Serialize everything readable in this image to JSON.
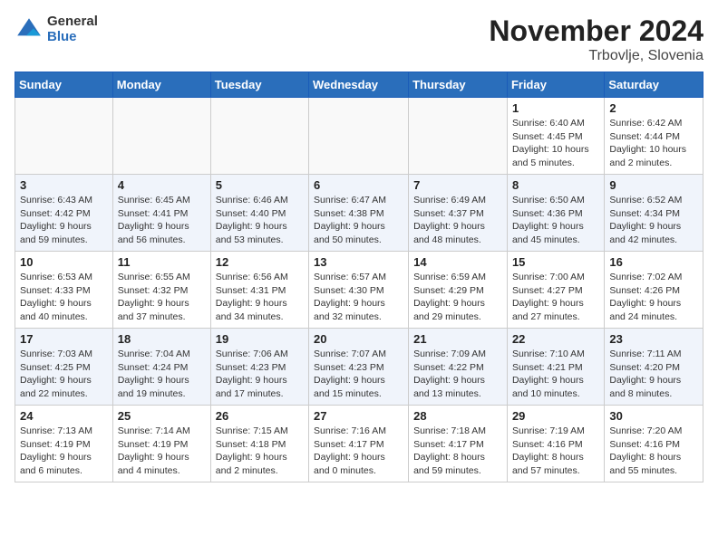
{
  "logo": {
    "general": "General",
    "blue": "Blue"
  },
  "header": {
    "month": "November 2024",
    "location": "Trbovlje, Slovenia"
  },
  "weekdays": [
    "Sunday",
    "Monday",
    "Tuesday",
    "Wednesday",
    "Thursday",
    "Friday",
    "Saturday"
  ],
  "weeks": [
    [
      {
        "day": "",
        "info": ""
      },
      {
        "day": "",
        "info": ""
      },
      {
        "day": "",
        "info": ""
      },
      {
        "day": "",
        "info": ""
      },
      {
        "day": "",
        "info": ""
      },
      {
        "day": "1",
        "info": "Sunrise: 6:40 AM\nSunset: 4:45 PM\nDaylight: 10 hours\nand 5 minutes."
      },
      {
        "day": "2",
        "info": "Sunrise: 6:42 AM\nSunset: 4:44 PM\nDaylight: 10 hours\nand 2 minutes."
      }
    ],
    [
      {
        "day": "3",
        "info": "Sunrise: 6:43 AM\nSunset: 4:42 PM\nDaylight: 9 hours\nand 59 minutes."
      },
      {
        "day": "4",
        "info": "Sunrise: 6:45 AM\nSunset: 4:41 PM\nDaylight: 9 hours\nand 56 minutes."
      },
      {
        "day": "5",
        "info": "Sunrise: 6:46 AM\nSunset: 4:40 PM\nDaylight: 9 hours\nand 53 minutes."
      },
      {
        "day": "6",
        "info": "Sunrise: 6:47 AM\nSunset: 4:38 PM\nDaylight: 9 hours\nand 50 minutes."
      },
      {
        "day": "7",
        "info": "Sunrise: 6:49 AM\nSunset: 4:37 PM\nDaylight: 9 hours\nand 48 minutes."
      },
      {
        "day": "8",
        "info": "Sunrise: 6:50 AM\nSunset: 4:36 PM\nDaylight: 9 hours\nand 45 minutes."
      },
      {
        "day": "9",
        "info": "Sunrise: 6:52 AM\nSunset: 4:34 PM\nDaylight: 9 hours\nand 42 minutes."
      }
    ],
    [
      {
        "day": "10",
        "info": "Sunrise: 6:53 AM\nSunset: 4:33 PM\nDaylight: 9 hours\nand 40 minutes."
      },
      {
        "day": "11",
        "info": "Sunrise: 6:55 AM\nSunset: 4:32 PM\nDaylight: 9 hours\nand 37 minutes."
      },
      {
        "day": "12",
        "info": "Sunrise: 6:56 AM\nSunset: 4:31 PM\nDaylight: 9 hours\nand 34 minutes."
      },
      {
        "day": "13",
        "info": "Sunrise: 6:57 AM\nSunset: 4:30 PM\nDaylight: 9 hours\nand 32 minutes."
      },
      {
        "day": "14",
        "info": "Sunrise: 6:59 AM\nSunset: 4:29 PM\nDaylight: 9 hours\nand 29 minutes."
      },
      {
        "day": "15",
        "info": "Sunrise: 7:00 AM\nSunset: 4:27 PM\nDaylight: 9 hours\nand 27 minutes."
      },
      {
        "day": "16",
        "info": "Sunrise: 7:02 AM\nSunset: 4:26 PM\nDaylight: 9 hours\nand 24 minutes."
      }
    ],
    [
      {
        "day": "17",
        "info": "Sunrise: 7:03 AM\nSunset: 4:25 PM\nDaylight: 9 hours\nand 22 minutes."
      },
      {
        "day": "18",
        "info": "Sunrise: 7:04 AM\nSunset: 4:24 PM\nDaylight: 9 hours\nand 19 minutes."
      },
      {
        "day": "19",
        "info": "Sunrise: 7:06 AM\nSunset: 4:23 PM\nDaylight: 9 hours\nand 17 minutes."
      },
      {
        "day": "20",
        "info": "Sunrise: 7:07 AM\nSunset: 4:23 PM\nDaylight: 9 hours\nand 15 minutes."
      },
      {
        "day": "21",
        "info": "Sunrise: 7:09 AM\nSunset: 4:22 PM\nDaylight: 9 hours\nand 13 minutes."
      },
      {
        "day": "22",
        "info": "Sunrise: 7:10 AM\nSunset: 4:21 PM\nDaylight: 9 hours\nand 10 minutes."
      },
      {
        "day": "23",
        "info": "Sunrise: 7:11 AM\nSunset: 4:20 PM\nDaylight: 9 hours\nand 8 minutes."
      }
    ],
    [
      {
        "day": "24",
        "info": "Sunrise: 7:13 AM\nSunset: 4:19 PM\nDaylight: 9 hours\nand 6 minutes."
      },
      {
        "day": "25",
        "info": "Sunrise: 7:14 AM\nSunset: 4:19 PM\nDaylight: 9 hours\nand 4 minutes."
      },
      {
        "day": "26",
        "info": "Sunrise: 7:15 AM\nSunset: 4:18 PM\nDaylight: 9 hours\nand 2 minutes."
      },
      {
        "day": "27",
        "info": "Sunrise: 7:16 AM\nSunset: 4:17 PM\nDaylight: 9 hours\nand 0 minutes."
      },
      {
        "day": "28",
        "info": "Sunrise: 7:18 AM\nSunset: 4:17 PM\nDaylight: 8 hours\nand 59 minutes."
      },
      {
        "day": "29",
        "info": "Sunrise: 7:19 AM\nSunset: 4:16 PM\nDaylight: 8 hours\nand 57 minutes."
      },
      {
        "day": "30",
        "info": "Sunrise: 7:20 AM\nSunset: 4:16 PM\nDaylight: 8 hours\nand 55 minutes."
      }
    ]
  ]
}
